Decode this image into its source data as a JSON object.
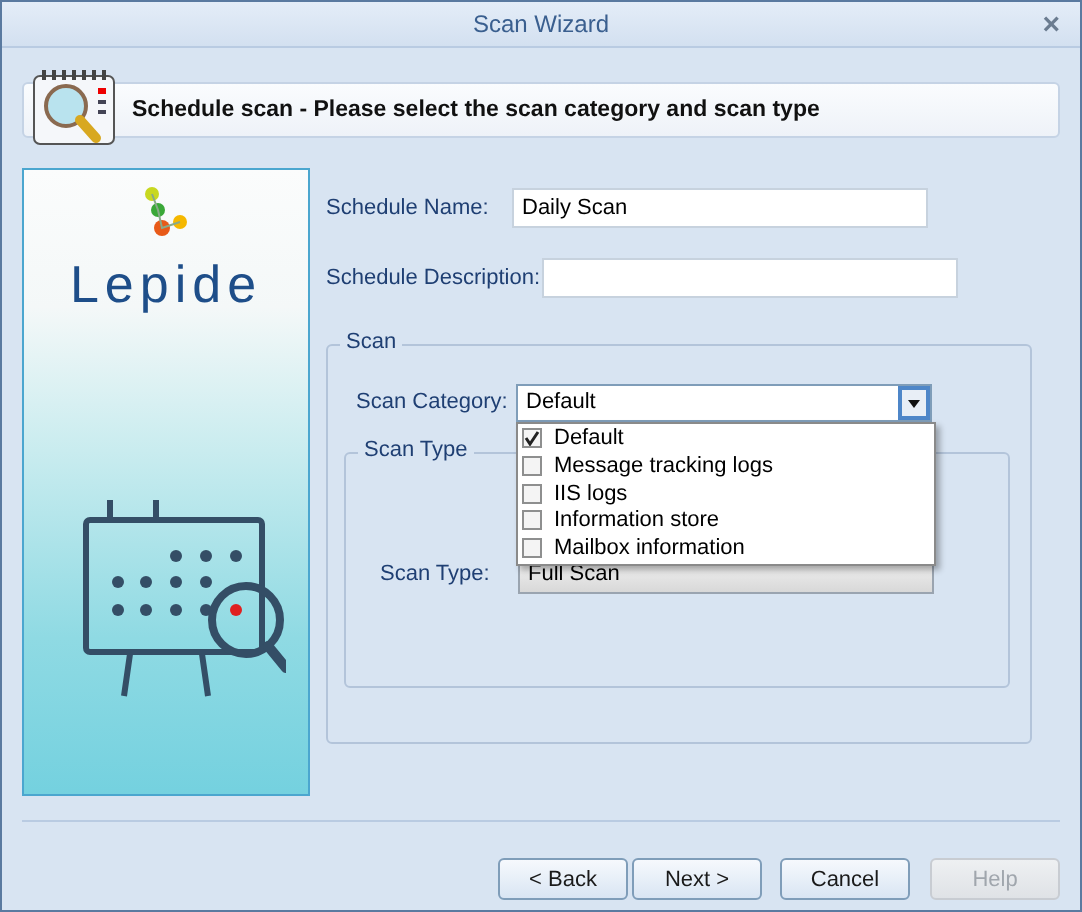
{
  "window": {
    "title": "Scan Wizard",
    "close": "×"
  },
  "header": {
    "text": "Schedule scan - Please select the scan category and scan type"
  },
  "brand": {
    "name": "Lepide"
  },
  "form": {
    "fields": [
      {
        "label": "Schedule Name:",
        "value": "Daily Scan"
      },
      {
        "label": "Schedule Description:"
      }
    ]
  },
  "scan_group": {
    "title": "Scan",
    "category_label": "Scan Category:",
    "category_value": "Default",
    "options": [
      {
        "label": "Default",
        "checked": true
      },
      {
        "label": "Message tracking logs",
        "checked": false
      },
      {
        "label": "IIS logs",
        "checked": false
      },
      {
        "label": "Information store",
        "checked": false
      },
      {
        "label": "Mailbox information",
        "checked": false
      }
    ],
    "type_group": {
      "title": "Scan Type",
      "label": "Scan Type:",
      "value": "Full Scan"
    }
  },
  "buttons": [
    {
      "label": "< Back",
      "disabled": false
    },
    {
      "label": "Next >",
      "disabled": false
    },
    {
      "label": "Cancel",
      "disabled": false
    },
    {
      "label": "Help",
      "disabled": true
    }
  ]
}
